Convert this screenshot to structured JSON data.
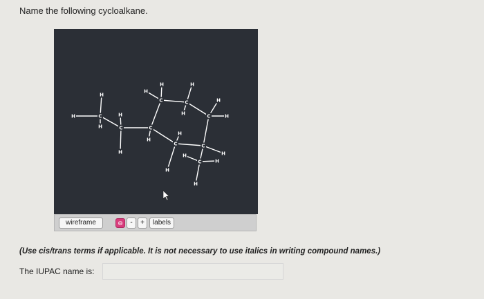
{
  "question": {
    "text": "Name the following cycloalkane."
  },
  "viewer": {
    "toolbar": {
      "wireframe_label": "wireframe",
      "toggle_glyph": "⊖",
      "minus_label": "-",
      "plus_label": "+",
      "labels_label": "labels"
    },
    "atom_symbols": {
      "carbon": "C",
      "hydrogen": "H"
    },
    "colors": {
      "background": "#2b2f36",
      "bond": "#ffffff",
      "toggle": "#d83c7c"
    },
    "cursor_icon": "pointer-arrow-icon"
  },
  "note": {
    "text": "(Use cis/trans terms if applicable. It is not necessary to use italics in writing compound names.)"
  },
  "answer": {
    "label": "The IUPAC name is:",
    "value": "",
    "placeholder": ""
  }
}
